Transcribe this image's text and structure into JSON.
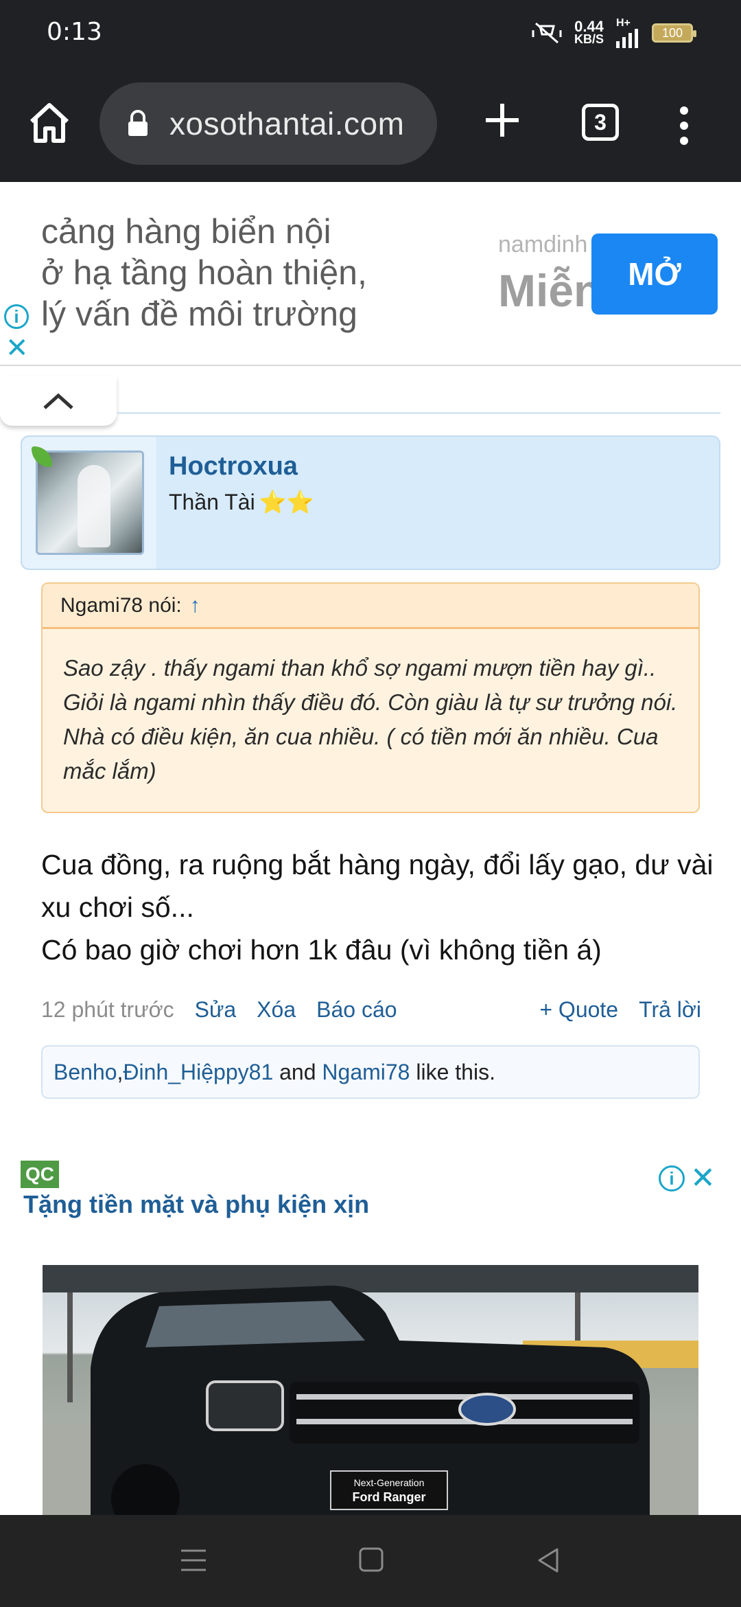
{
  "status_bar": {
    "time": "0:13",
    "net_speed_value": "0.44",
    "net_speed_unit": "KB/S",
    "network_type": "H+",
    "battery": "100"
  },
  "browser": {
    "url": "xosothantai.com",
    "tab_count": "3"
  },
  "top_ad": {
    "lines": [
      "cảng hàng biển nội",
      "ở hạ tầng hoàn thiện,",
      "lý vấn đề môi trường"
    ],
    "domain": "namdinh",
    "headline": "Miễn",
    "button_label": "MỞ"
  },
  "post": {
    "author": "Hoctroxua",
    "author_title": "Thần Tài",
    "author_stars": "⭐⭐",
    "quote": {
      "header": "Ngami78 nói:",
      "arrow": "↑",
      "text": "Sao zậy . thấy ngami than khổ sợ ngami mượn tiền hay gì.. Giỏi là ngami nhìn thấy điều đó. Còn giàu là tự sư trưởng nói. Nhà có điều kiện, ăn cua nhiều. ( có tiền mới ăn nhiều. Cua mắc lắm)"
    },
    "message_lines": [
      "Cua đồng, ra ruộng bắt hàng ngày, đổi lấy gạo, dư vài xu chơi số...",
      "Có bao giờ chơi hơn 1k đâu (vì không tiền á)"
    ],
    "time_ago": "12 phút trước",
    "actions": {
      "edit": "Sửa",
      "delete": "Xóa",
      "report": "Báo cáo",
      "quote": "+ Quote",
      "reply": "Trả lời"
    },
    "likes": {
      "user1": "Benho",
      "sep1": ", ",
      "user2": "Đinh_Hiệppy81",
      "and": " and ",
      "user3": "Ngami78",
      "suffix": " like this."
    }
  },
  "bottom_ad": {
    "badge": "QC",
    "title": "Tặng tiền mặt và phụ kiện xịn",
    "image_plate_line1": "Next-Generation",
    "image_plate_line2": "Ford Ranger"
  },
  "colors": {
    "link": "#1f5e96",
    "ad_accent": "#1a87f2",
    "info_icon": "#1aa6c9",
    "user_card_bg": "#d7ebfb",
    "quote_bg": "#fff3e0"
  }
}
